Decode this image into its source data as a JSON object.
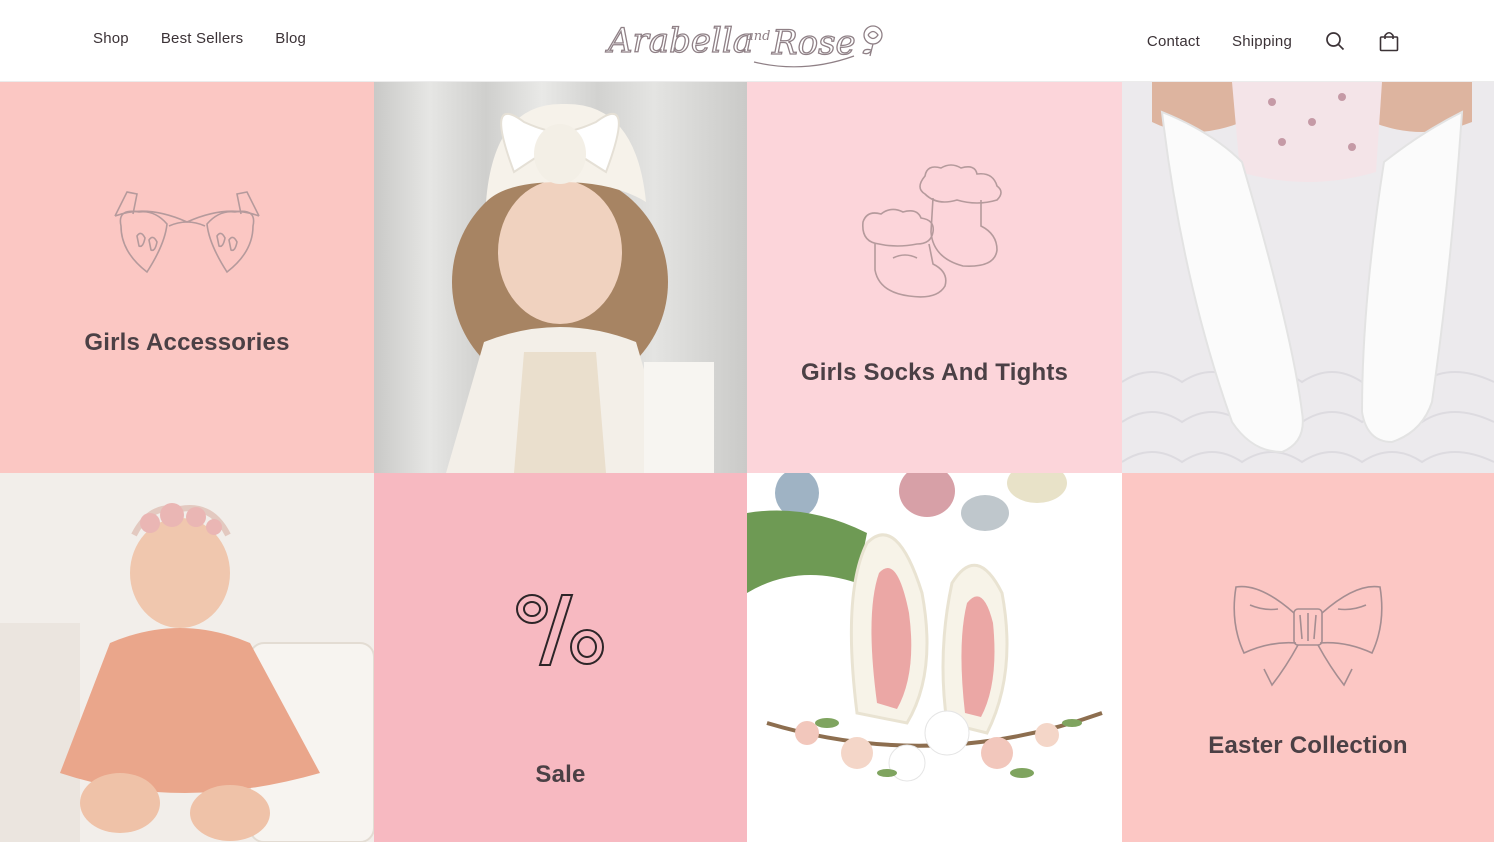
{
  "header": {
    "nav_left": [
      "Shop",
      "Best Sellers",
      "Blog"
    ],
    "nav_right": [
      "Contact",
      "Shipping"
    ],
    "logo_text": "Arabella and Rose",
    "icons": [
      "search-icon",
      "cart-icon"
    ]
  },
  "tiles": [
    {
      "type": "category",
      "label": "Girls Accessories",
      "icon": "heart-sunglasses-icon",
      "bg": "#fbc7c3"
    },
    {
      "type": "photo",
      "subject": "toddler-in-white-turban",
      "bg": "#dcdcdc"
    },
    {
      "type": "category",
      "label": "Girls Socks And Tights",
      "icon": "frilly-socks-icon",
      "bg": "#fcd5da"
    },
    {
      "type": "photo",
      "subject": "baby-legs-in-knee-socks",
      "bg": "#f1f1f3"
    },
    {
      "type": "photo",
      "subject": "baby-in-peach-dress",
      "bg": "#f1ece8"
    },
    {
      "type": "category",
      "label": "Sale",
      "icon": "percent-icon",
      "bg": "#f7b9c1"
    },
    {
      "type": "photo",
      "subject": "bunny-ears-headband",
      "bg": "#ffffff"
    },
    {
      "type": "category",
      "label": "Easter Collection",
      "icon": "bow-icon",
      "bg": "#fcc7c4"
    }
  ],
  "colors": {
    "text": "#4b4045",
    "line_icon": "#a08a8f",
    "accent_pink": "#f7b9c1"
  }
}
